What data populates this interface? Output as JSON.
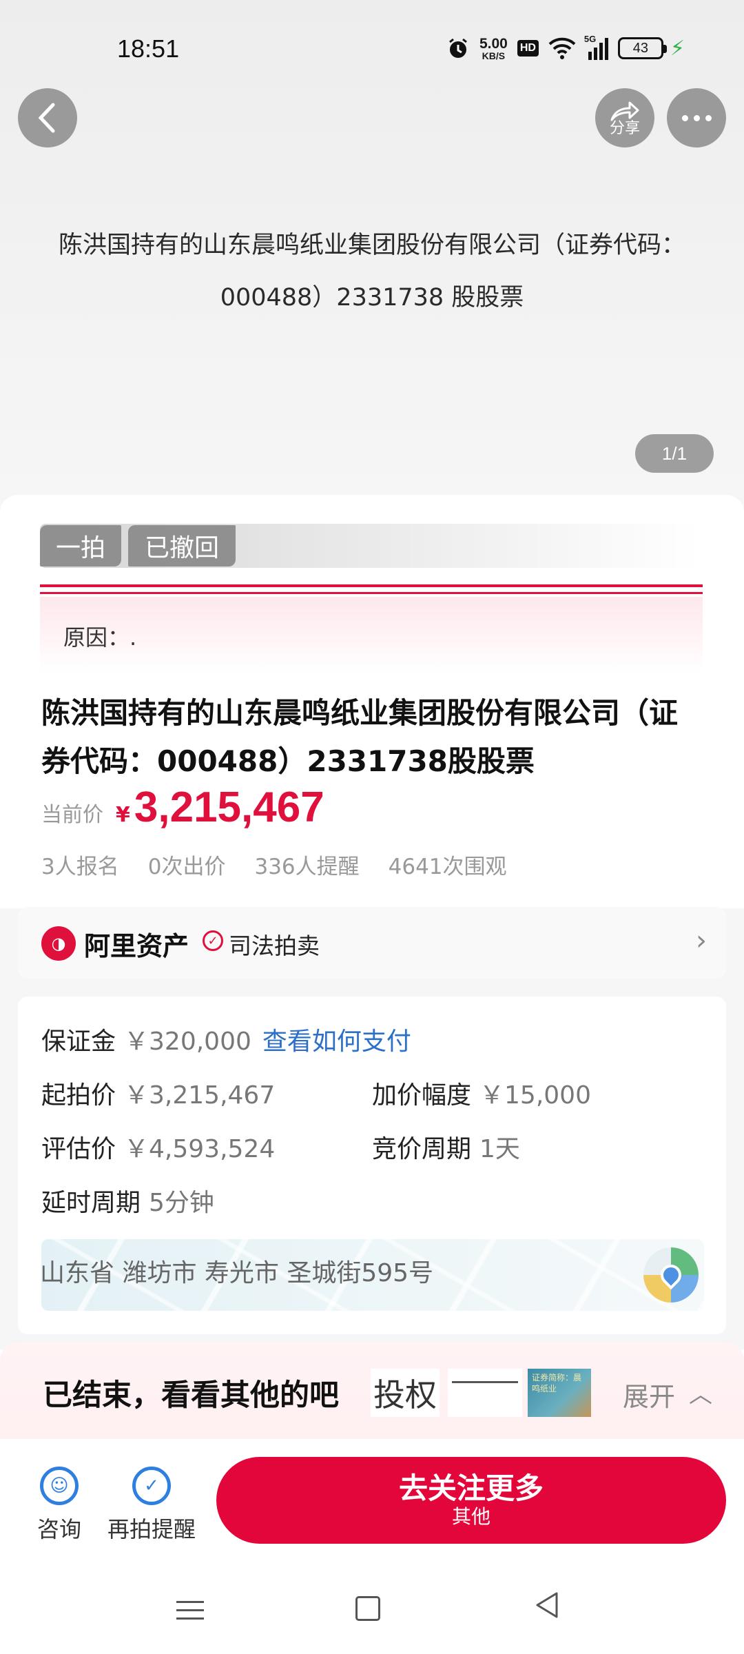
{
  "status_bar": {
    "time": "18:51",
    "net_speed_value": "5.00",
    "net_speed_unit": "KB/S",
    "hd": "HD",
    "signal": "5G",
    "battery": "43"
  },
  "header": {
    "share_label": "分享",
    "icons": {
      "back": "chevron-left-icon",
      "share": "share-icon",
      "more": "more-dots-icon"
    }
  },
  "hero": {
    "title_line1": "陈洪国持有的山东晨鸣纸业集团股份有限公司（证券代码：",
    "title_line2": "000488）2331738 股股票",
    "pager": "1/1"
  },
  "tags": {
    "round": "一拍",
    "status": "已撤回"
  },
  "reason": "原因：.",
  "item": {
    "title": "陈洪国持有的山东晨鸣纸业集团股份有限公司（证券代码：000488）2331738股股票",
    "price_label": "当前价",
    "currency": "¥",
    "price": "3,215,467",
    "stats": [
      "3人报名",
      "0次出价",
      "336人提醒",
      "4641次围观"
    ]
  },
  "brand": {
    "name": "阿里资产",
    "law_label": "司法拍卖"
  },
  "info": {
    "deposit_label": "保证金",
    "deposit_value": "￥320,000",
    "pay_link": "查看如何支付",
    "start_label": "起拍价",
    "start_value": "￥3,215,467",
    "increment_label": "加价幅度",
    "increment_value": "￥15,000",
    "appraisal_label": "评估价",
    "appraisal_value": "￥4,593,524",
    "cycle_label": "竞价周期",
    "cycle_value": "1天",
    "delay_label": "延时周期",
    "delay_value": "5分钟",
    "address": "山东省 潍坊市 寿光市 圣城街595号"
  },
  "ended": {
    "text": "已结束，看看其他的吧",
    "thumb_1_text": "投权",
    "thumb_3_text": "证券简称：晨鸣纸业",
    "expand": "展开"
  },
  "actions": {
    "consult": "咨询",
    "remind": "再拍提醒",
    "cta_main": "去关注更多",
    "cta_sub": "其他"
  },
  "colors": {
    "accent_red": "#e3063a",
    "link_blue": "#2c6fc8",
    "tag_gray": "#909090"
  }
}
